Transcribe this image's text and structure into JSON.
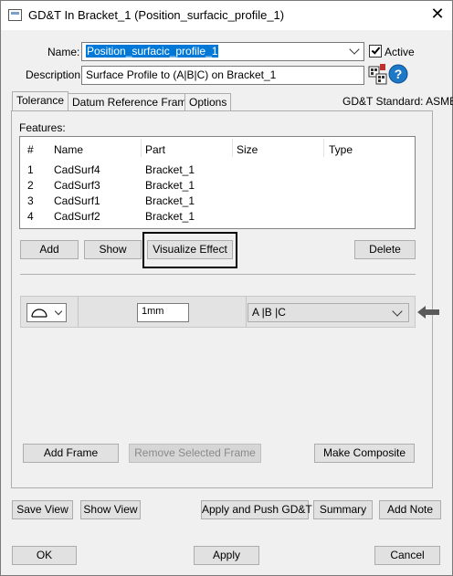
{
  "window": {
    "title": "GD&T In Bracket_1 (Position_surfacic_profile_1)",
    "close_glyph": "✕"
  },
  "name": {
    "label": "Name:",
    "value": "Position_surfacic_profile_1"
  },
  "active": {
    "label": "Active",
    "checked": true
  },
  "description": {
    "label": "Description:",
    "value": "Surface Profile to (A|B|C) on Bracket_1"
  },
  "tabs": [
    {
      "label": "Tolerance",
      "active": true
    },
    {
      "label": "Datum Reference Frame",
      "active": false
    },
    {
      "label": "Options",
      "active": false
    }
  ],
  "standard": "GD&T Standard: ASME",
  "features": {
    "label": "Features:",
    "columns": [
      "#",
      "Name",
      "Part",
      "Size",
      "Type"
    ],
    "rows": [
      {
        "num": "1",
        "name": "CadSurf4",
        "part": "Bracket_1",
        "size": "",
        "type": ""
      },
      {
        "num": "2",
        "name": "CadSurf3",
        "part": "Bracket_1",
        "size": "",
        "type": ""
      },
      {
        "num": "3",
        "name": "CadSurf1",
        "part": "Bracket_1",
        "size": "",
        "type": ""
      },
      {
        "num": "4",
        "name": "CadSurf2",
        "part": "Bracket_1",
        "size": "",
        "type": ""
      }
    ]
  },
  "feature_buttons": {
    "add": "Add",
    "show": "Show",
    "visualize": "Visualize Effect",
    "delete": "Delete"
  },
  "frame": {
    "tolerance_value": "1mm",
    "datums": "A |B |C"
  },
  "frame_buttons": {
    "add_frame": "Add Frame",
    "remove_frame": "Remove Selected Frame",
    "make_composite": "Make Composite"
  },
  "bottom_buttons": {
    "save_view": "Save View",
    "show_view": "Show View",
    "apply_push": "Apply and Push GD&T",
    "summary": "Summary",
    "add_note": "Add Note"
  },
  "dialog_buttons": {
    "ok": "OK",
    "apply": "Apply",
    "cancel": "Cancel"
  },
  "colors": {
    "selection": "#0078d7",
    "help": "#1e78c8",
    "highlight_border": "#000000"
  },
  "icons": [
    "window-icon",
    "close-icon",
    "chevron-down-icon",
    "checkbox-icon",
    "datum-tool-icon",
    "help-icon",
    "surface-profile-icon",
    "arrow-left-icon"
  ]
}
